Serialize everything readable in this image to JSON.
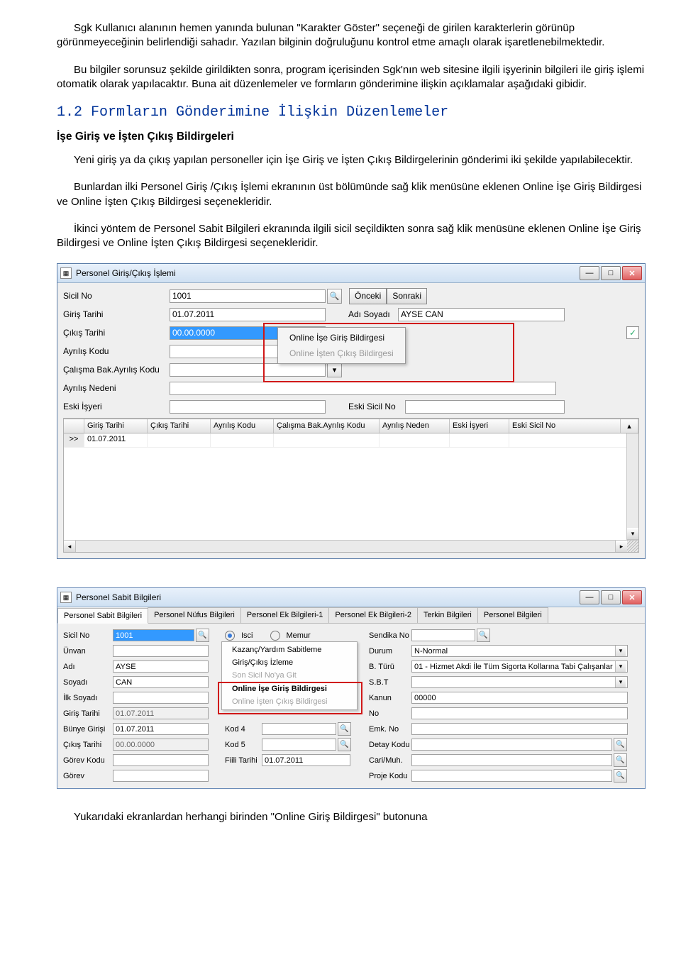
{
  "text": {
    "p1": "Sgk Kullanıcı alanının hemen yanında bulunan \"Karakter Göster\" seçeneği de girilen karakterlerin görünüp görünmeyeceğinin belirlendiği sahadır. Yazılan bilginin doğruluğunu kontrol etme amaçlı olarak işaretlenebilmektedir.",
    "p2": "Bu bilgiler sorunsuz şekilde girildikten sonra, program içerisinden Sgk'nın web sitesine ilgili işyerinin bilgileri ile giriş işlemi otomatik olarak yapılacaktır. Buna ait düzenlemeler ve formların gönderimine ilişkin açıklamalar aşağıdaki gibidir.",
    "sec": "1.2  Formların Gönderimine İlişkin Düzenlemeler",
    "sub": "İşe Giriş ve İşten Çıkış Bildirgeleri",
    "p3": "Yeni giriş ya da çıkış yapılan personeller için İşe Giriş ve İşten Çıkış Bildirgelerinin gönderimi iki şekilde yapılabilecektir.",
    "p4": "Bunlardan ilki Personel Giriş /Çıkış İşlemi ekranının üst bölümünde sağ klik menüsüne eklenen Online İşe Giriş Bildirgesi ve Online İşten Çıkış Bildirgesi seçenekleridir.",
    "p5": "İkinci yöntem de Personel Sabit Bilgileri ekranında ilgili sicil seçildikten sonra sağ klik menüsüne eklenen Online İşe Giriş Bildirgesi ve Online İşten Çıkış Bildirgesi seçenekleridir.",
    "footer": "Yukarıdaki ekranlardan herhangi birinden \"Online Giriş Bildirgesi\" butonuna"
  },
  "shot1": {
    "title": "Personel Giriş/Çıkış İşlemi",
    "labels": {
      "sicil": "Sicil No",
      "giris": "Giriş Tarihi",
      "cikis": "Çıkış Tarihi",
      "ayrilis": "Ayrılış Kodu",
      "calisma": "Çalışma Bak.Ayrılış Kodu",
      "neden": "Ayrılış Nedeni",
      "eski_isyeri": "Eski İşyeri",
      "onceki": "Önceki",
      "sonraki": "Sonraki",
      "adi_soyadi": "Adı Soyadı",
      "eski_sicil": "Eski Sicil No"
    },
    "fields": {
      "sicil": "1001",
      "giris": "01.07.2011",
      "cikis": "00.00.0000",
      "adi_soyadi": "AYSE CAN"
    },
    "menu": {
      "m1": "Online İşe Giriş Bildirgesi",
      "m2": "Online İşten Çıkış Bildirgesi"
    },
    "grid": {
      "headers": [
        "Giriş Tarihi",
        "Çıkış Tarihi",
        "Ayrılış Kodu",
        "Çalışma Bak.Ayrılış Kodu",
        "Ayrılış Neden",
        "Eski İşyeri",
        "Eski Sicil No"
      ],
      "row0_c0": "01.07.2011",
      "rowmark": ">>"
    }
  },
  "shot2": {
    "title": "Personel Sabit Bilgileri",
    "tabs": [
      "Personel Sabit Bilgileri",
      "Personel Nüfus Bilgileri",
      "Personel Ek Bilgileri-1",
      "Personel Ek Bilgileri-2",
      "Terkin Bilgileri",
      "Personel Bilgileri"
    ],
    "left": {
      "sicil": "Sicil No",
      "unvan": "Ünvan",
      "adi": "Adı",
      "soyadi": "Soyadı",
      "ilksoyadi": "İlk Soyadı",
      "giris": "Giriş Tarihi",
      "bunye": "Bünye Girişi",
      "cikis": "Çıkış Tarihi",
      "gorevkodu": "Görev Kodu",
      "gorev": "Görev"
    },
    "lvals": {
      "sicil": "1001",
      "adi": "AYSE",
      "soyadi": "CAN",
      "giris": "01.07.2011",
      "bunye": "01.07.2011",
      "cikis": "00.00.0000"
    },
    "radios": {
      "isci": "Isci",
      "memur": "Memur"
    },
    "midlbl": {
      "kod4": "Kod 4",
      "kod5": "Kod 5",
      "fiili": "Fiili Tarihi"
    },
    "midval": {
      "fiili": "01.07.2011"
    },
    "rightlbl": {
      "sendika": "Sendika No",
      "durum": "Durum",
      "bturu": "B. Türü",
      "sbt": "S.B.T",
      "kanun": "Kanun",
      "no": "No",
      "emk": "Emk. No",
      "detay": "Detay Kodu",
      "cari": "Cari/Muh.",
      "proje": "Proje Kodu"
    },
    "rvals": {
      "durum": "N-Normal",
      "bturu": "01 - Hizmet Akdi İle Tüm Sigorta Kollarına Tabi Çalışanlar",
      "kanun": "00000"
    },
    "menu": {
      "a": "Kazanç/Yardım Sabitleme",
      "b": "Giriş/Çıkış İzleme",
      "c": "Son Sicil No'ya Git",
      "d": "Online İşe Giriş Bildirgesi",
      "e": "Online İşten Çıkış Bildirgesi"
    }
  }
}
